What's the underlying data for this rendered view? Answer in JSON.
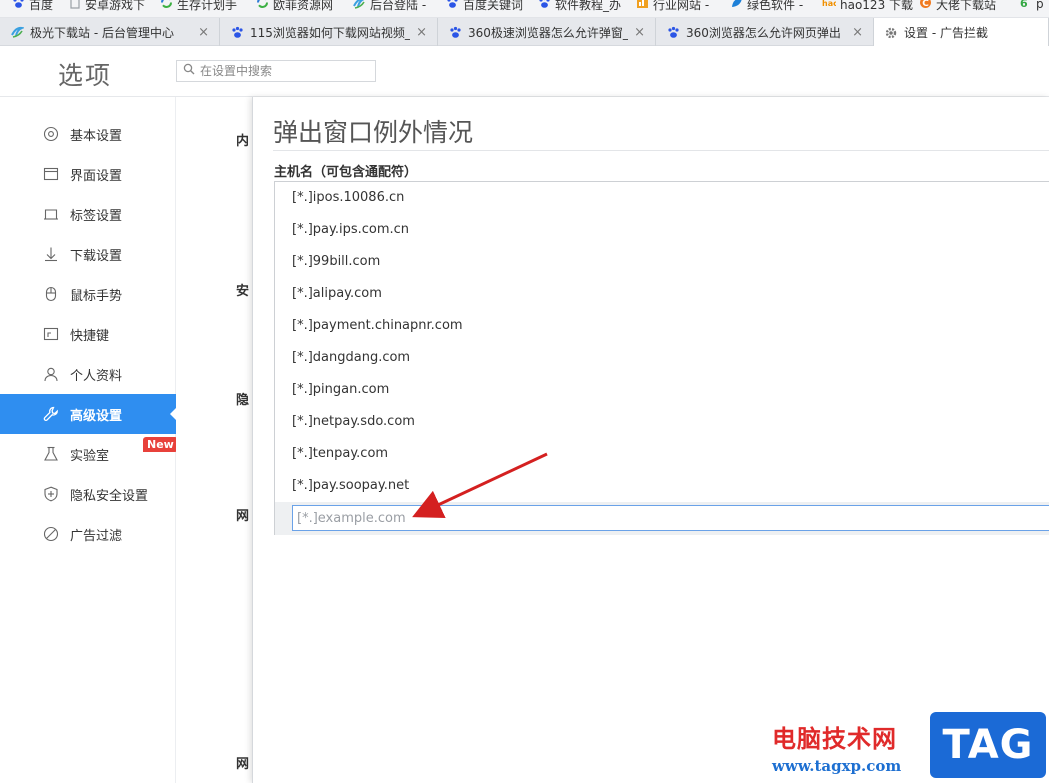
{
  "bookmarks": [
    {
      "label": "百度",
      "icon": "paw-icon",
      "color": "#2b55e6"
    },
    {
      "label": "安卓游戏下",
      "icon": "page-icon",
      "color": "#9aa0a6"
    },
    {
      "label": "生存计划手",
      "icon": "sync-icon",
      "color": "#2e7bd6"
    },
    {
      "label": "欧菲资源网",
      "icon": "sync-icon",
      "color": "#2e7bd6"
    },
    {
      "label": "后台登陆 -",
      "icon": "swirl-icon",
      "color": "#3aa0e0"
    },
    {
      "label": "百度关键词",
      "icon": "paw-icon",
      "color": "#2b55e6"
    },
    {
      "label": "软件教程_办",
      "icon": "paw-icon",
      "color": "#2b55e6"
    },
    {
      "label": "行业网站 -",
      "icon": "chart-icon",
      "color": "#f0a020"
    },
    {
      "label": "绿色软件 -",
      "icon": "leaf-icon",
      "color": "#1d80d8"
    },
    {
      "label": "hao123 下载",
      "icon": "hao-icon",
      "color": "#f09000"
    },
    {
      "label": "大佬下载站",
      "icon": "c-icon",
      "color": "#f07a20"
    },
    {
      "label": "p",
      "icon": "six-icon",
      "color": "#35a845"
    }
  ],
  "tabs": [
    {
      "title": "极光下载站 - 后台管理中心",
      "icon": "swirl-icon",
      "color": "#3aa0e0"
    },
    {
      "title": "115浏览器如何下载网站视频_",
      "icon": "paw-icon",
      "color": "#2b55e6"
    },
    {
      "title": "360极速浏览器怎么允许弹窗_",
      "icon": "paw-icon",
      "color": "#2b55e6"
    },
    {
      "title": "360浏览器怎么允许网页弹出",
      "icon": "paw-icon",
      "color": "#2b55e6"
    },
    {
      "title": "设置 - 广告拦截",
      "icon": "gear-icon",
      "color": "#777777"
    }
  ],
  "close_glyph": "×",
  "header": {
    "title": "选项",
    "search_placeholder": "在设置中搜索"
  },
  "sidebar": {
    "accent": "#2f8ef0",
    "items": [
      {
        "label": "基本设置",
        "icon": "gear-circle-icon"
      },
      {
        "label": "界面设置",
        "icon": "window-icon"
      },
      {
        "label": "标签设置",
        "icon": "tab-icon"
      },
      {
        "label": "下载设置",
        "icon": "download-arrow-icon"
      },
      {
        "label": "鼠标手势",
        "icon": "mouse-icon"
      },
      {
        "label": "快捷键",
        "icon": "shortcut-icon"
      },
      {
        "label": "个人资料",
        "icon": "person-icon"
      },
      {
        "label": "高级设置",
        "icon": "wrench-icon",
        "active": true
      },
      {
        "label": "实验室",
        "icon": "flask-icon",
        "badge": "New"
      },
      {
        "label": "隐私安全设置",
        "icon": "shield-plus-icon"
      },
      {
        "label": "广告过滤",
        "icon": "no-entry-icon"
      }
    ]
  },
  "content": {
    "section_labels": [
      "内",
      "安",
      "隐",
      "网",
      "网"
    ]
  },
  "dialog": {
    "title": "弹出窗口例外情况",
    "list_header": "主机名（可包含通配符）",
    "hosts": [
      "[*.]ipos.10086.cn",
      "[*.]pay.ips.com.cn",
      "[*.]99bill.com",
      "[*.]alipay.com",
      "[*.]payment.chinapnr.com",
      "[*.]dangdang.com",
      "[*.]pingan.com",
      "[*.]netpay.sdo.com",
      "[*.]tenpay.com",
      "[*.]pay.soopay.net"
    ],
    "new_host_placeholder": "[*.]example.com",
    "new_host_value": ""
  },
  "annotation": {
    "arrow_color": "#d42020"
  },
  "watermark": {
    "text": "电脑技术网",
    "url": "www.tagxp.com",
    "tag": "TAG"
  }
}
